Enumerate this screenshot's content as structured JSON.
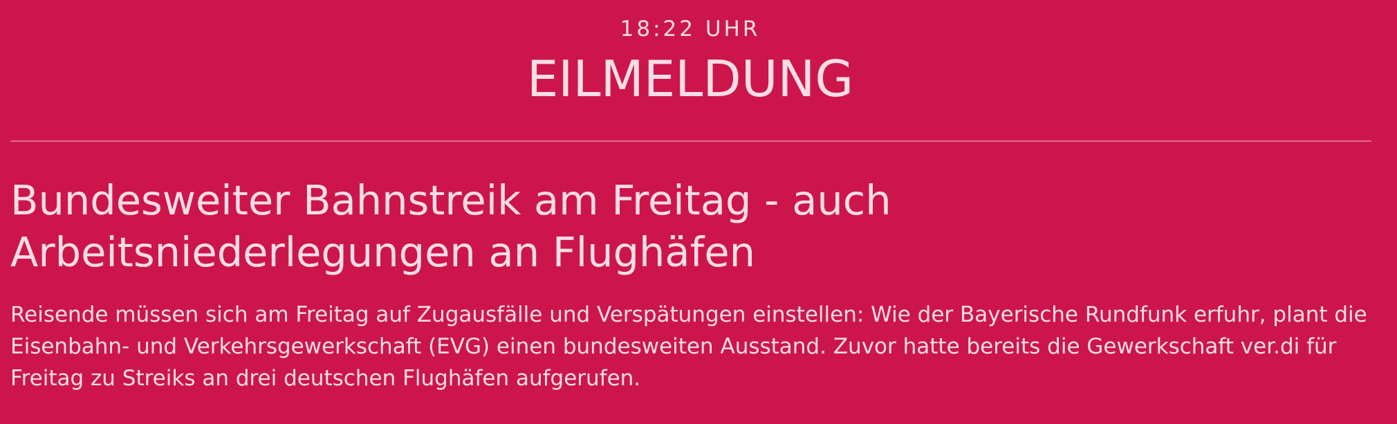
{
  "breaking_news": {
    "time": "18:22 UHR",
    "label": "EILMELDUNG",
    "headline_line1": "Bundesweiter Bahnstreik am Freitag - auch",
    "headline_line2": "Arbeitsniederlegungen an Flughäfen",
    "body": "Reisende müssen sich am Freitag auf Zugausfälle und Verspätungen einstellen: Wie der Bayerische Rundfunk erfuhr, plant die Eisenbahn- und Verkehrsgewerkschaft (EVG) einen bundesweiten Ausstand. Zuvor hatte bereits die Gewerkschaft ver.di für Freitag zu Streiks an drei deutschen Flughäfen aufgerufen."
  },
  "colors": {
    "background": "#cc164b",
    "text": "#f7dde6",
    "divider": "#e06d8c"
  }
}
